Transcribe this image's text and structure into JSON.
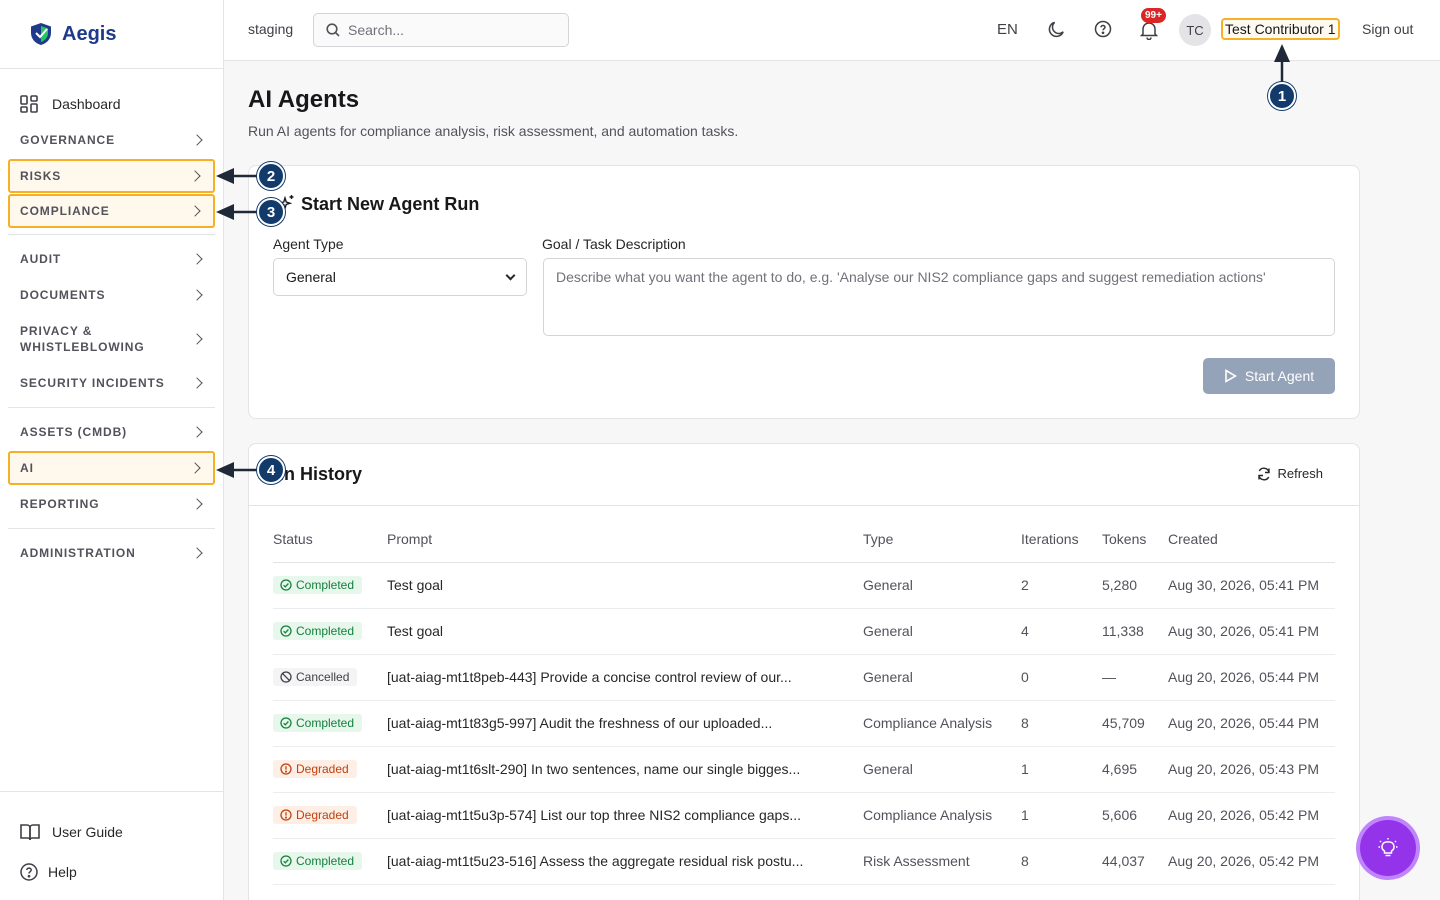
{
  "brand": {
    "name": "Aegis"
  },
  "sidebar": {
    "dashboard": "Dashboard",
    "sections": {
      "governance": "GOVERNANCE",
      "risks": "RISKS",
      "compliance": "COMPLIANCE",
      "audit": "AUDIT",
      "documents": "DOCUMENTS",
      "privacy_line1": "PRIVACY &",
      "privacy_line2": "WHISTLEBLOWING",
      "security": "SECURITY INCIDENTS",
      "assets": "ASSETS (CMDB)",
      "ai": "AI",
      "reporting": "REPORTING",
      "administration": "ADMINISTRATION"
    },
    "user_guide": "User Guide",
    "help": "Help"
  },
  "header": {
    "env": "staging",
    "search_placeholder": "Search...",
    "lang": "EN",
    "notif_badge": "99+",
    "avatar": "TC",
    "user": "Test Contributor 1",
    "signout": "Sign out"
  },
  "page": {
    "title": "AI Agents",
    "subtitle": "Run AI agents for compliance analysis, risk assessment, and automation tasks."
  },
  "new_run": {
    "title": "Start New Agent Run",
    "agent_type_label": "Agent Type",
    "agent_type_value": "General",
    "goal_label": "Goal / Task Description",
    "goal_placeholder": "Describe what you want the agent to do, e.g. 'Analyse our NIS2 compliance gaps and suggest remediation actions'",
    "start_button": "Start Agent"
  },
  "history": {
    "title": "un History",
    "refresh": "Refresh",
    "columns": [
      "Status",
      "Prompt",
      "Type",
      "Iterations",
      "Tokens",
      "Created"
    ],
    "rows": [
      {
        "status": "Completed",
        "prompt": "Test goal",
        "type": "General",
        "iterations": "2",
        "tokens": "5,280",
        "created": "Aug 30, 2026, 05:41 PM"
      },
      {
        "status": "Completed",
        "prompt": "Test goal",
        "type": "General",
        "iterations": "4",
        "tokens": "11,338",
        "created": "Aug 30, 2026, 05:41 PM"
      },
      {
        "status": "Cancelled",
        "prompt": "[uat-aiag-mt1t8peb-443] Provide a concise control review of our...",
        "type": "General",
        "iterations": "0",
        "tokens": "—",
        "created": "Aug 20, 2026, 05:44 PM"
      },
      {
        "status": "Completed",
        "prompt": "[uat-aiag-mt1t83g5-997] Audit the freshness of our uploaded...",
        "type": "Compliance Analysis",
        "iterations": "8",
        "tokens": "45,709",
        "created": "Aug 20, 2026, 05:44 PM"
      },
      {
        "status": "Degraded",
        "prompt": "[uat-aiag-mt1t6slt-290] In two sentences, name our single bigges...",
        "type": "General",
        "iterations": "1",
        "tokens": "4,695",
        "created": "Aug 20, 2026, 05:43 PM"
      },
      {
        "status": "Degraded",
        "prompt": "[uat-aiag-mt1t5u3p-574] List our top three NIS2 compliance gaps...",
        "type": "Compliance Analysis",
        "iterations": "1",
        "tokens": "5,606",
        "created": "Aug 20, 2026, 05:42 PM"
      },
      {
        "status": "Completed",
        "prompt": "[uat-aiag-mt1t5u23-516] Assess the aggregate residual risk postu...",
        "type": "Risk Assessment",
        "iterations": "8",
        "tokens": "44,037",
        "created": "Aug 20, 2026, 05:42 PM"
      }
    ]
  },
  "callouts": [
    "1",
    "2",
    "3",
    "4"
  ],
  "colors": {
    "highlight": "#f5b027",
    "callout": "#123a6b",
    "brand": "#1e3a8a",
    "fab": "#9333ea"
  }
}
